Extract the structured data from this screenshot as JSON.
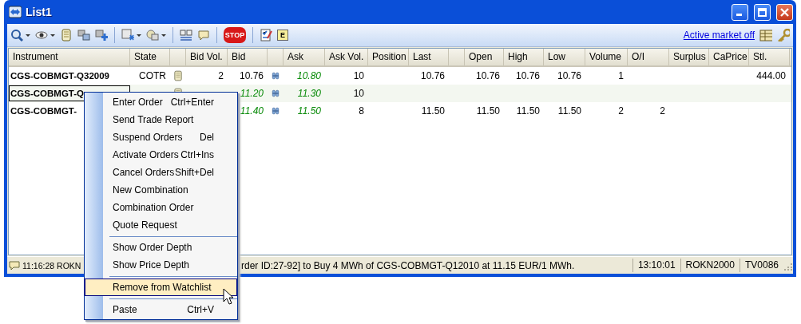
{
  "window": {
    "title": "List1"
  },
  "toolbar": {
    "stop_label": "STOP",
    "e_label": "E",
    "link": "Active market off"
  },
  "table": {
    "columns": [
      {
        "kind": "text",
        "label": "Instrument"
      },
      {
        "kind": "text",
        "label": "State"
      },
      {
        "kind": "blank"
      },
      {
        "kind": "text",
        "label": "Bid Vol."
      },
      {
        "kind": "text",
        "label": "Bid"
      },
      {
        "kind": "blank"
      },
      {
        "kind": "text",
        "label": "Ask"
      },
      {
        "kind": "text",
        "label": "Ask Vol."
      },
      {
        "kind": "text",
        "label": "Position"
      },
      {
        "kind": "text",
        "label": "Last"
      },
      {
        "kind": "blank"
      },
      {
        "kind": "text",
        "label": "Open"
      },
      {
        "kind": "text",
        "label": "High"
      },
      {
        "kind": "text",
        "label": "Low"
      },
      {
        "kind": "text",
        "label": "Volume"
      },
      {
        "kind": "text",
        "label": "O/I"
      },
      {
        "kind": "text",
        "label": "Surplus"
      },
      {
        "kind": "text",
        "label": "CaPrice"
      },
      {
        "kind": "text",
        "label": "Stl."
      }
    ],
    "rows": [
      {
        "instrument": "CGS-COBMGT-Q32009",
        "focused": false,
        "state": "COTR",
        "order_icon": true,
        "bid_vol": "2",
        "bid": "10.76",
        "bid_implied": false,
        "depth_icon": true,
        "ask": "10.80",
        "ask_implied": true,
        "ask_vol": "10",
        "last": "10.76",
        "open": "10.76",
        "high": "10.76",
        "low": "10.76",
        "volume": "1",
        "stl": "444.00"
      },
      {
        "instrument": "CGS-COBMGT-Q",
        "focused": true,
        "order_icon": true,
        "bid": "11.20",
        "bid_implied": true,
        "depth_icon": true,
        "ask": "11.30",
        "ask_implied": true,
        "ask_vol": "10"
      },
      {
        "instrument": "CGS-COBMGT-",
        "focused": false,
        "bid": "11.40",
        "bid_implied": true,
        "depth_icon": true,
        "ask": "11.50",
        "ask_implied": true,
        "ask_vol": "8",
        "last": "11.50",
        "open": "11.50",
        "high": "11.50",
        "low": "11.50",
        "volume": "2",
        "oi": "2"
      }
    ]
  },
  "context_menu": {
    "items": [
      {
        "kind": "item",
        "label": "Enter Order",
        "shortcut": "Ctrl+Enter",
        "selected": false
      },
      {
        "kind": "item",
        "label": "Send Trade Report",
        "selected": false
      },
      {
        "kind": "item",
        "label": "Suspend Orders",
        "shortcut": "Del",
        "selected": false
      },
      {
        "kind": "item",
        "label": "Activate Orders",
        "shortcut": "Ctrl+Ins",
        "selected": false
      },
      {
        "kind": "item",
        "label": "Cancel Orders",
        "shortcut": "Shift+Del",
        "selected": false
      },
      {
        "kind": "item",
        "label": "New Combination",
        "selected": false
      },
      {
        "kind": "item",
        "label": "Combination Order",
        "selected": false
      },
      {
        "kind": "item",
        "label": "Quote Request",
        "selected": false
      },
      {
        "kind": "separator"
      },
      {
        "kind": "item",
        "label": "Show Order Depth",
        "selected": false
      },
      {
        "kind": "item",
        "label": "Show Price Depth",
        "selected": false
      },
      {
        "kind": "separator"
      },
      {
        "kind": "item",
        "label": "Remove from Watchlist",
        "selected": true
      },
      {
        "kind": "separator"
      },
      {
        "kind": "item",
        "label": "Paste",
        "shortcut": "Ctrl+V",
        "selected": false
      }
    ]
  },
  "status_bar": {
    "time": "11:16:28",
    "user": "ROKN",
    "message": "rder ID:27-92] to Buy 4 MWh of CGS-COBMGT-Q12010 at 11.15 EUR/1 MWh.",
    "server_time": "13:10:01",
    "account": "ROKN2000",
    "terminal": "TV0086"
  }
}
